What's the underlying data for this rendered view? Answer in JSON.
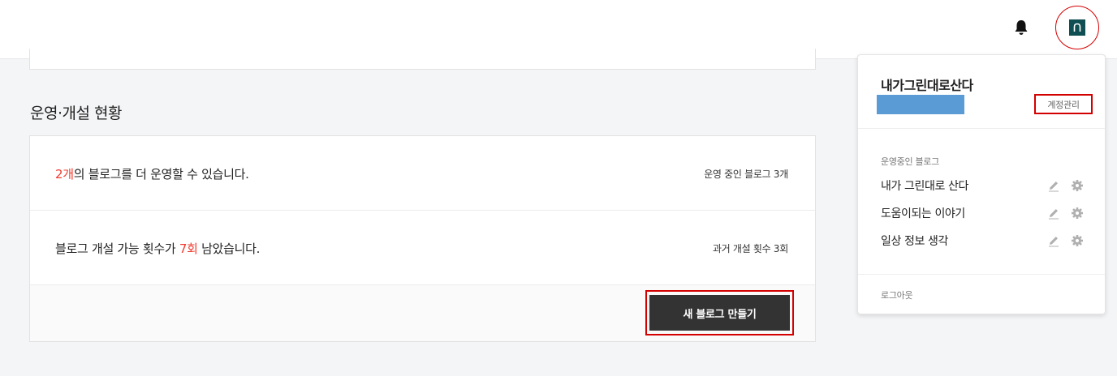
{
  "header": {
    "bell_icon": "bell-icon",
    "avatar_letter": "n"
  },
  "section_title": "운영·개설 현황",
  "status": {
    "blog_count_highlight": "2개",
    "blog_count_text": "의 블로그를 더 운영할 수 있습니다.",
    "operating_meta": "운영 중인 블로그 3개",
    "create_text_before": "블로그 개설 가능 횟수가 ",
    "create_highlight": "7회",
    "create_text_after": " 남았습니다.",
    "past_meta": "과거 개설 횟수 3회",
    "new_blog_button": "새 블로그 만들기"
  },
  "dropdown": {
    "user_name": "내가그린대로산다",
    "account_manage": "계정관리",
    "section_label": "운영중인 블로그",
    "blogs": [
      {
        "name": "내가 그린대로 산다"
      },
      {
        "name": "도움이되는 이야기"
      },
      {
        "name": "일상 정보 생각"
      }
    ],
    "logout": "로그아웃"
  },
  "colors": {
    "accent_red": "#f03c2f",
    "annotation_red": "#d40000",
    "avatar_bg": "#0f4e52",
    "button_dark": "#333333",
    "email_placeholder": "#5b9bd5"
  }
}
